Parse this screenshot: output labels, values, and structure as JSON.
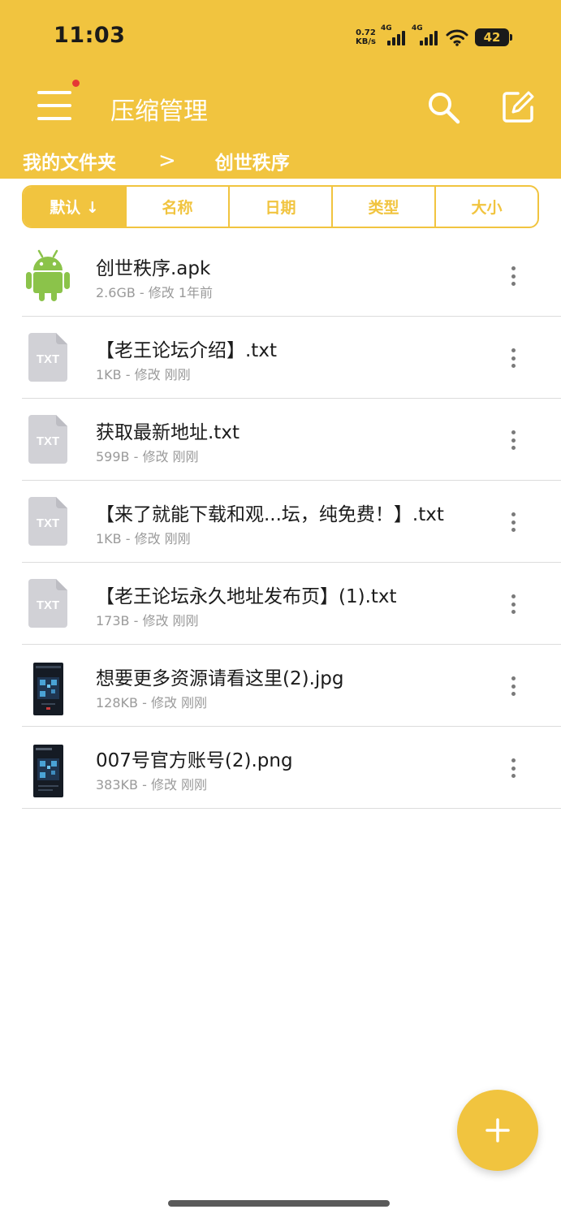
{
  "status_bar": {
    "time": "11:03",
    "net_speed_value": "0.72",
    "net_speed_unit": "KB/s",
    "sim1_label": "4G",
    "sim2_label": "4G",
    "battery": "42"
  },
  "toolbar": {
    "title": "压缩管理",
    "menu_icon": "hamburger-menu-icon",
    "search_icon": "search-icon",
    "edit_icon": "edit-icon"
  },
  "breadcrumb": {
    "root": "我的文件夹",
    "separator": ">",
    "current": "创世秩序"
  },
  "sort_tabs": [
    {
      "label": "默认 ↓",
      "active": true
    },
    {
      "label": "名称",
      "active": false
    },
    {
      "label": "日期",
      "active": false
    },
    {
      "label": "类型",
      "active": false
    },
    {
      "label": "大小",
      "active": false
    }
  ],
  "files": [
    {
      "name": "创世秩序.apk",
      "meta": "2.6GB - 修改 1年前",
      "icon": "android-icon"
    },
    {
      "name": "【老王论坛介绍】.txt",
      "meta": "1KB - 修改 刚刚",
      "icon": "txt-file-icon",
      "icon_text": "TXT"
    },
    {
      "name": "获取最新地址.txt",
      "meta": "599B - 修改 刚刚",
      "icon": "txt-file-icon",
      "icon_text": "TXT"
    },
    {
      "name": "【来了就能下载和观...坛，纯免费！】.txt",
      "meta": "1KB - 修改 刚刚",
      "icon": "txt-file-icon",
      "icon_text": "TXT"
    },
    {
      "name": "【老王论坛永久地址发布页】(1).txt",
      "meta": "173B - 修改 刚刚",
      "icon": "txt-file-icon",
      "icon_text": "TXT"
    },
    {
      "name": "想要更多资源请看这里(2).jpg",
      "meta": "128KB - 修改 刚刚",
      "icon": "image-thumbnail"
    },
    {
      "name": "007号官方账号(2).png",
      "meta": "383KB - 修改 刚刚",
      "icon": "image-thumbnail"
    }
  ],
  "fab": {
    "icon": "plus-icon"
  },
  "colors": {
    "accent": "#F1C43F",
    "badge": "#E53935",
    "android": "#8BC34A",
    "file_icon": "#D1D1D6"
  }
}
